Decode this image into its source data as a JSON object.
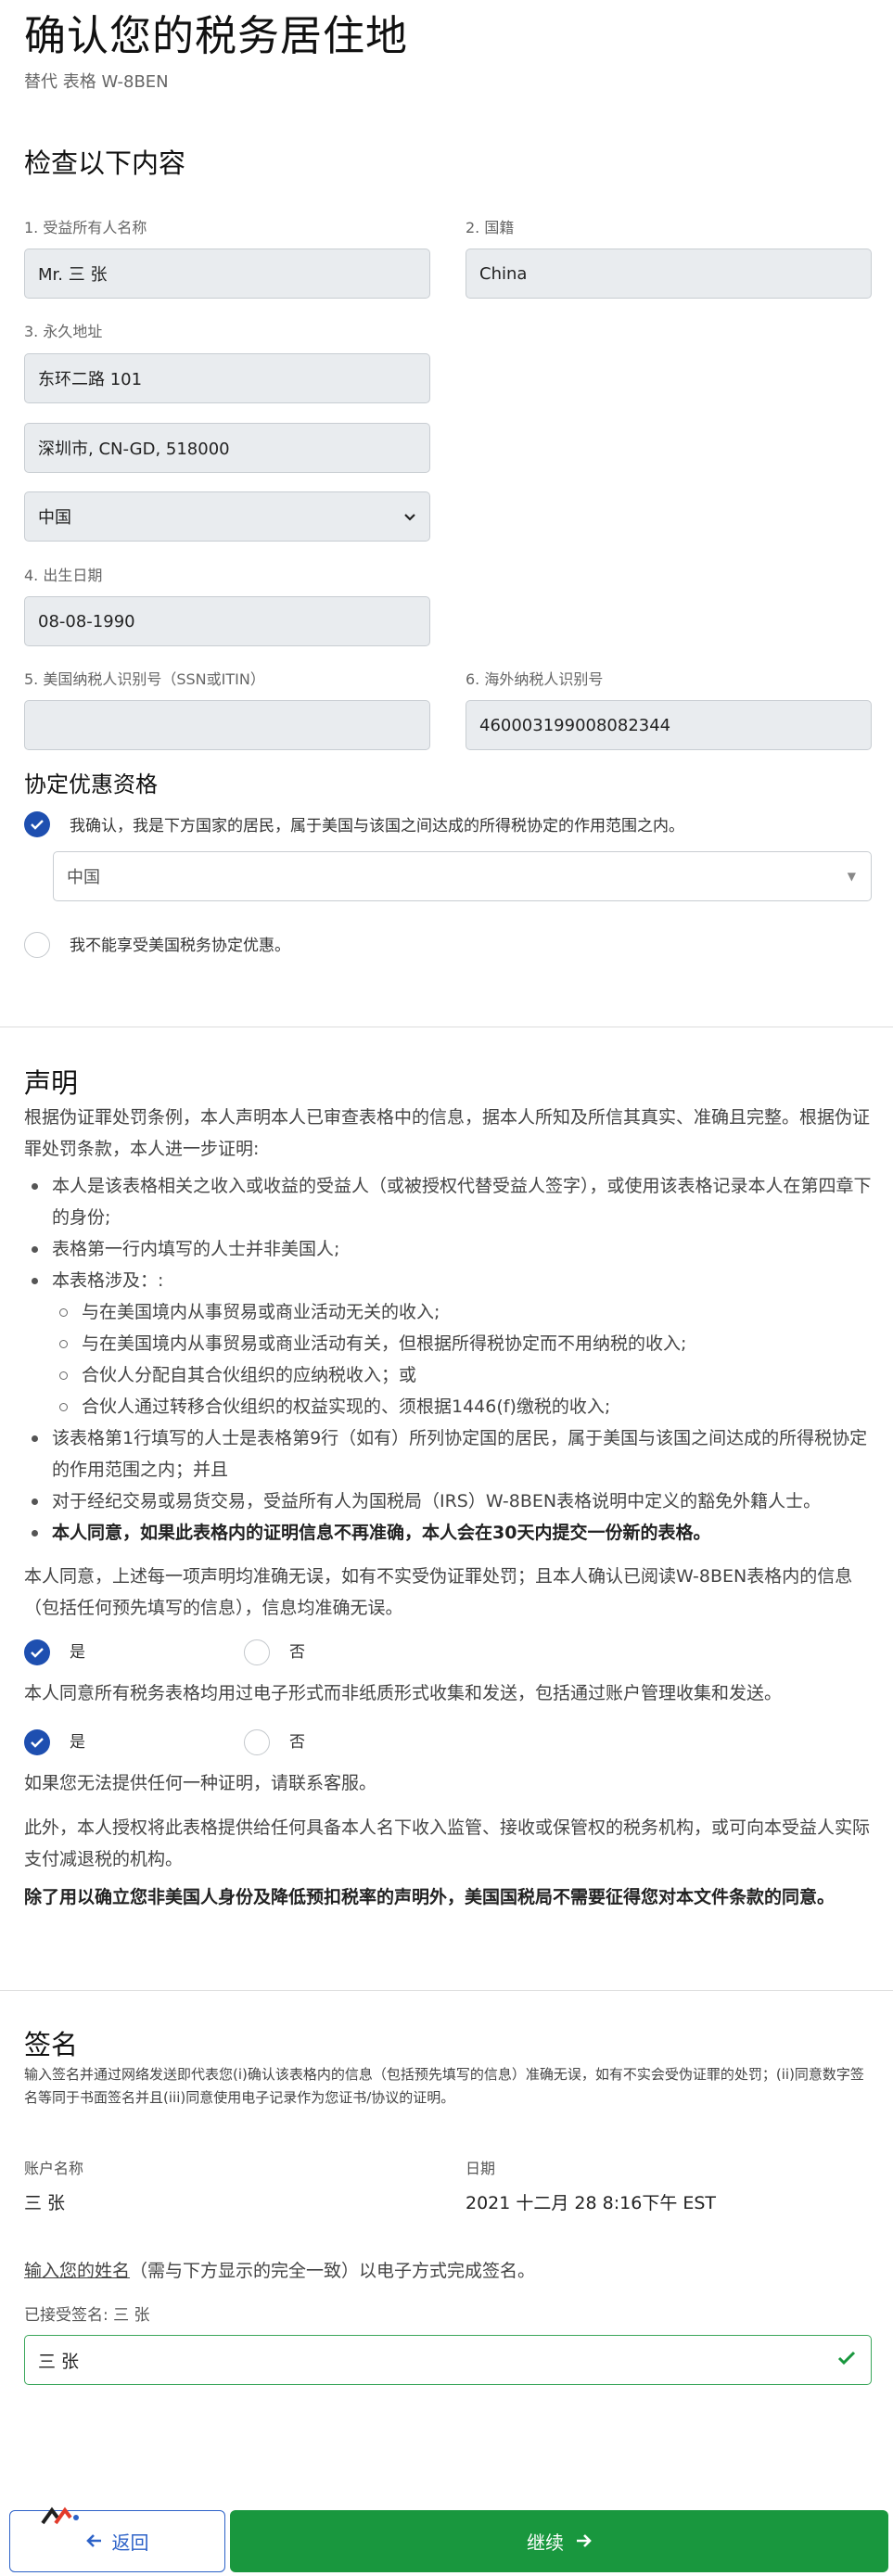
{
  "header": {
    "title": "确认您的税务居住地",
    "subtitle": "替代 表格 W-8BEN"
  },
  "review": {
    "heading": "检查以下内容",
    "name_label": "1. 受益所有人名称",
    "name_value": "Mr. 三 张",
    "nationality_label": "2. 国籍",
    "nationality_value": "China",
    "address_label": "3. 永久地址",
    "address_line1": "东环二路 101",
    "address_line2": "深圳市, CN-GD, 518000",
    "country_value": "中国",
    "dob_label": "4. 出生日期",
    "dob_value": "08-08-1990",
    "us_tin_label": "5. 美国纳税人识别号（SSN或ITIN）",
    "us_tin_value": "",
    "foreign_tin_label": "6. 海外纳税人识别号",
    "foreign_tin_value": "460003199008082344"
  },
  "treaty": {
    "heading": "协定优惠资格",
    "option_yes": "我确认，我是下方国家的居民，属于美国与该国之间达成的所得税协定的作用范围之内。",
    "country_value": "中国",
    "option_no": "我不能享受美国税务协定优惠。"
  },
  "declaration": {
    "heading": "声明",
    "intro": "根据伪证罪处罚条例，本人声明本人已审查表格中的信息，据本人所知及所信其真实、准确且完整。根据伪证罪处罚条款，本人进一步证明:",
    "items": [
      "本人是该表格相关之收入或收益的受益人（或被授权代替受益人签字），或使用该表格记录本人在第四章下的身份;",
      "表格第一行内填写的人士并非美国人;",
      "本表格涉及：:",
      "与在美国境内从事贸易或商业活动无关的收入;",
      "与在美国境内从事贸易或商业活动有关，但根据所得税协定而不用纳税的收入;",
      "合伙人分配自其合伙组织的应纳税收入；或",
      "合伙人通过转移合伙组织的权益实现的、须根据1446(f)缴税的收入;",
      "该表格第1行填写的人士是表格第9行（如有）所列协定国的居民，属于美国与该国之间达成的所得税协定的作用范围之内；并且",
      "对于经纪交易或易货交易，受益所有人为国税局（IRS）W-8BEN表格说明中定义的豁免外籍人士。",
      "本人同意，如果此表格内的证明信息不再准确，本人会在30天内提交一份新的表格。"
    ],
    "consent1": "本人同意，上述每一项声明均准确无误，如有不实受伪证罪处罚；且本人确认已阅读W-8BEN表格内的信息（包括任何预先填写的信息），信息均准确无误。",
    "yes_label": "是",
    "no_label": "否",
    "consent2": "本人同意所有税务表格均用过电子形式而非纸质形式收集和发送，包括通过账户管理收集和发送。",
    "contact": "如果您无法提供任何一种证明，请联系客服。",
    "authorize": "此外，本人授权将此表格提供给任何具备本人名下收入监管、接收或保管权的税务机构，或可向本受益人实际支付减退税的机构。",
    "irs_note": "除了用以确立您非美国人身份及降低预扣税率的声明外，美国国税局不需要征得您对本文件条款的同意。"
  },
  "signature": {
    "heading": "签名",
    "note": "输入签名并通过网络发送即代表您(i)确认该表格内的信息（包括预先填写的信息）准确无误，如有不实会受伪证罪的处罚；(ii)同意数字签名等同于书面签名并且(iii)同意使用电子记录作为您证书/协议的证明。",
    "account_label": "账户名称",
    "account_value": "三 张",
    "date_label": "日期",
    "date_value": "2021 十二月 28 8:16下午 EST",
    "instruction_link": "输入您的姓名",
    "instruction_rest": "（需与下方显示的完全一致）以电子方式完成签名。",
    "accepted_label": "已接受签名: 三 张",
    "signature_value": "三 张"
  },
  "footer": {
    "back_label": "返回",
    "next_label": "继续"
  },
  "colors": {
    "primary_blue": "#1e4fb0",
    "success_green": "#19973e"
  }
}
